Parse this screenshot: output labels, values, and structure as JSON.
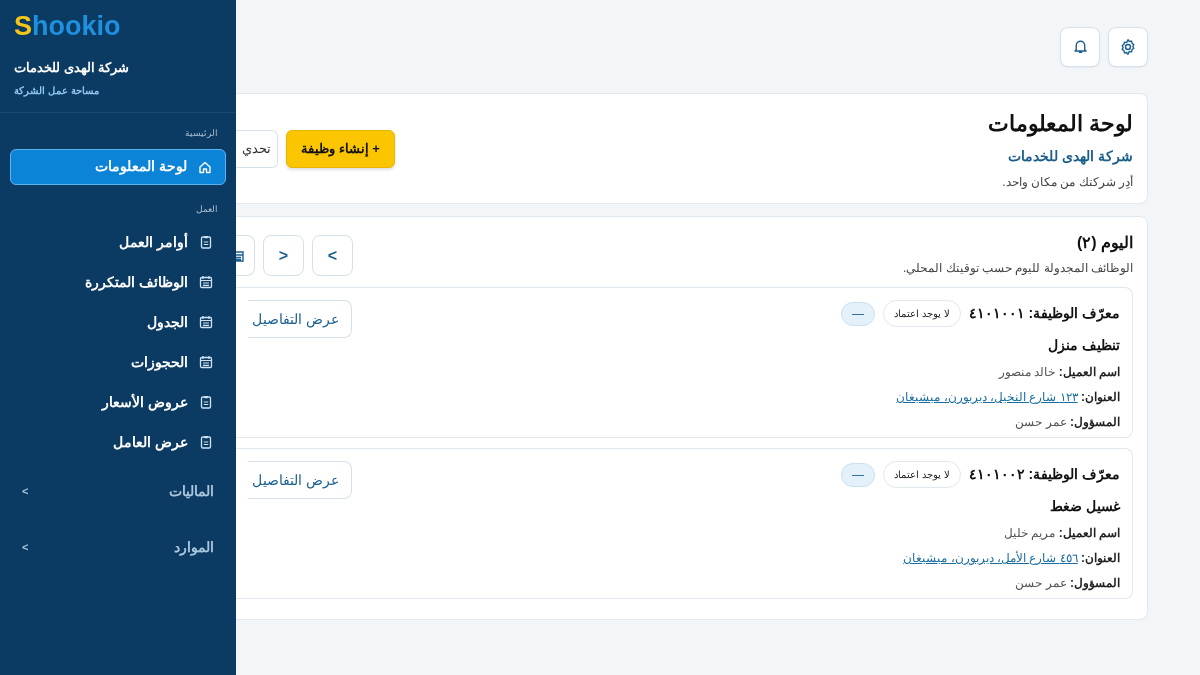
{
  "sidebar": {
    "logo": {
      "initial": "S",
      "rest": "hookio"
    },
    "company": "شركة الهدى للخدمات",
    "workspace": "مساحة عمل الشركة",
    "sections": [
      {
        "title": "الرئيسية",
        "items": [
          {
            "label": "لوحة المعلومات",
            "kind": "home",
            "selected": true
          }
        ]
      },
      {
        "title": "العمل",
        "items": [
          {
            "label": "أوامر العمل",
            "kind": "clipboard",
            "selected": false
          },
          {
            "label": "الوظائف المتكررة",
            "kind": "calendar",
            "selected": false
          },
          {
            "label": "الجدول",
            "kind": "calendar",
            "selected": false
          },
          {
            "label": "الحجوزات",
            "kind": "calendar",
            "selected": false
          },
          {
            "label": "عروض الأسعار",
            "kind": "clipboard",
            "selected": false
          },
          {
            "label": "عرض العامل",
            "kind": "clipboard",
            "selected": false
          }
        ]
      }
    ],
    "groups": [
      {
        "label": "الماليات",
        "caret": "<"
      },
      {
        "label": "الموارد",
        "caret": "<"
      }
    ]
  },
  "header": {
    "title": "لوحة المعلومات",
    "company": "شركة الهدى للخدمات",
    "tagline": "أدِر شركتك من مكان واحد.",
    "create_button": "+ إنشاء وظيفة",
    "refresh_button": "تحدي"
  },
  "today": {
    "title": "اليوم (٢)",
    "subtitle": "الوظائف المجدولة لليوم حسب توقيتك المحلي.",
    "nav_buttons": [
      ">",
      "<"
    ],
    "jobs": [
      {
        "id_label": "معرّف الوظيفة:",
        "id": "٤١٠١٠٠١",
        "approval": "لا يوجد اعتماد",
        "status": "—",
        "service": "تنظيف منزل",
        "client_label": "اسم العميل:",
        "client": "خالد منصور",
        "address_label": "العنوان:",
        "address": "١٢٣ شارع النخيل، ديربورن، ميشيغان",
        "assignee_label": "المسؤول:",
        "assignee": "عمر حسن",
        "details_button": "عرض التفاصيل"
      },
      {
        "id_label": "معرّف الوظيفة:",
        "id": "٤١٠١٠٠٢",
        "approval": "لا يوجد اعتماد",
        "status": "—",
        "service": "غسيل ضغط",
        "client_label": "اسم العميل:",
        "client": "مريم خليل",
        "address_label": "العنوان:",
        "address": "٤٥٦ شارع الأمل، ديربورن، ميشيغان",
        "assignee_label": "المسؤول:",
        "assignee": "عمر حسن",
        "details_button": "عرض التفاصيل"
      }
    ]
  }
}
